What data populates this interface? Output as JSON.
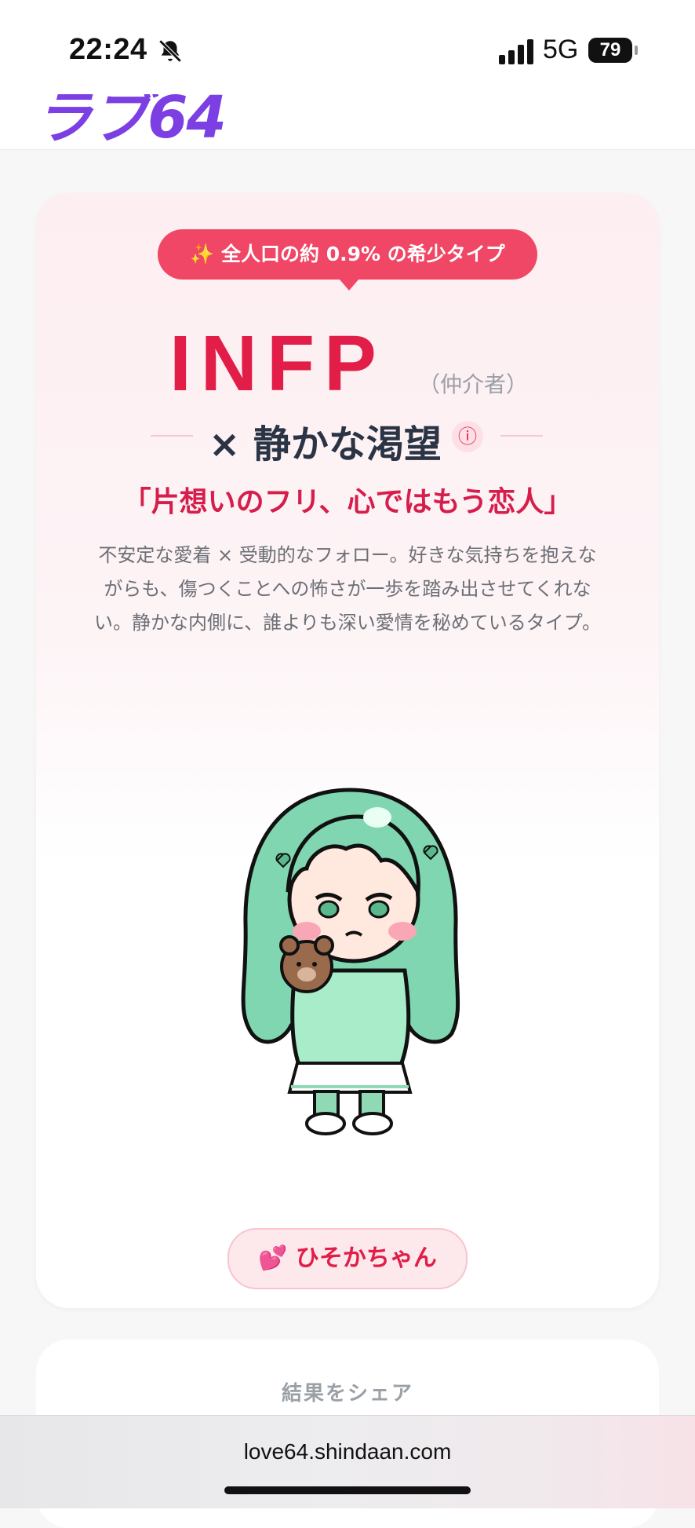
{
  "status_bar": {
    "time": "22:24",
    "network": "5G",
    "battery": "79"
  },
  "site": {
    "logo_text": "ラブ64"
  },
  "result": {
    "rarity_badge": "✨ 全人口の約 0.9% の希少タイプ",
    "type_code": "INFP",
    "type_name": "（仲介者）",
    "subtype": "× 静かな渇望",
    "catchphrase": "「片想いのフリ、心ではもう恋人」",
    "description": "不安定な愛着 × 受動的なフォロー。好きな気持ちを抱えながらも、傷つくことへの怖さが一歩を踏み出させてくれない。静かな内側に、誰よりも深い愛情を秘めているタイプ。",
    "character_button": "💕 ひそかちゃん"
  },
  "share": {
    "title": "結果をシェア"
  },
  "browser": {
    "url": "love64.shindaan.com"
  },
  "colors": {
    "accent": "#e11d48",
    "badge": "#ef4765",
    "logo": "#7b3fe4"
  }
}
